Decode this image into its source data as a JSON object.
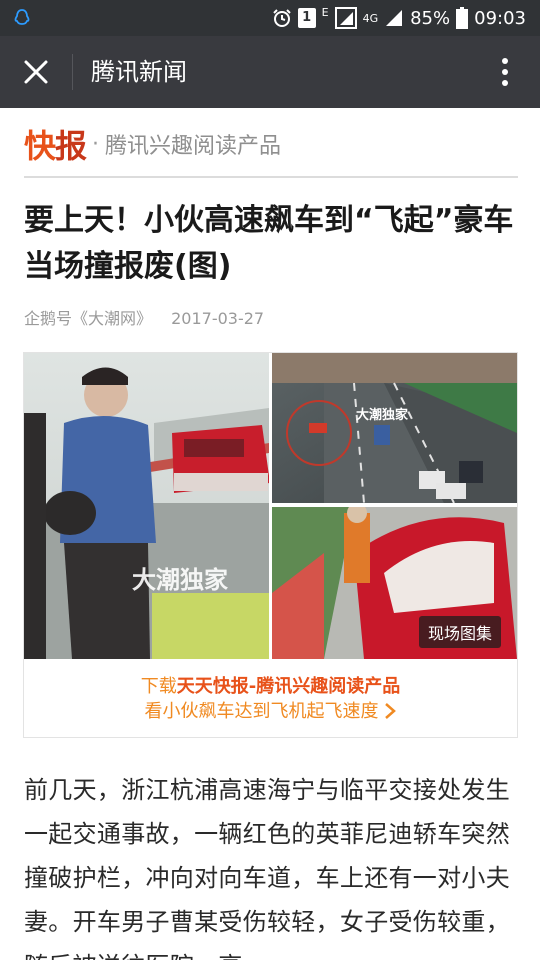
{
  "status_bar": {
    "battery": "85%",
    "time": "09:03",
    "network": "4G",
    "sim": "1",
    "edge": "E",
    "icons": [
      "qq-icon",
      "alarm-icon",
      "sim-icon",
      "edge-icon",
      "signal-box-icon",
      "4g-icon",
      "signal-icon",
      "battery-icon"
    ]
  },
  "app_bar": {
    "title": "腾讯新闻",
    "close_icon": "close-icon",
    "more_icon": "more-vertical-icon"
  },
  "brand": {
    "logo_part1": "快",
    "logo_part2": "报",
    "separator": "·",
    "tagline": "腾讯兴趣阅读产品"
  },
  "article": {
    "title": "要上天！小伙高速飙车到“飞起”豪车当场撞报废(图)",
    "source": "企鹅号《大潮网》",
    "date": "2017-03-27",
    "image_watermark_1": "大潮独家",
    "image_watermark_2": "大潮独家",
    "gallery_badge": "现场图集",
    "cta_prefix": "下载",
    "cta_highlight": "天天快报-腾讯兴趣阅读产品",
    "cta_line2": "看小伙飙车达到飞机起飞速度",
    "body": "前几天，浙江杭浦高速海宁与临平交接处发生一起交通事故，一辆红色的英菲尼迪轿车突然撞破护栏，冲向对向车道，车上还有一对小夫妻。开车男子曹某受伤较轻，女子受伤较重，随后被送往医院。高"
  },
  "colors": {
    "status_bar_bg": "#303336",
    "app_bar_bg": "#393a3f",
    "brand_orange": "#e8521a",
    "cta_orange": "#f08a22",
    "meta_gray": "#9a9a9a"
  }
}
